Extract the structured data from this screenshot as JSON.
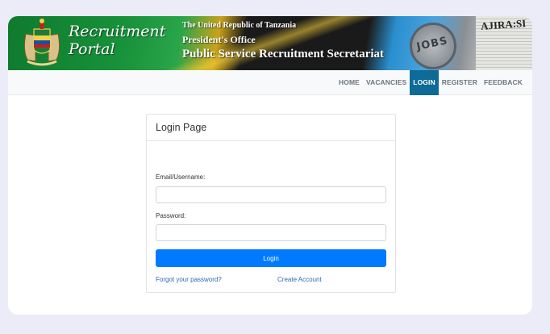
{
  "banner": {
    "portal_title_line1": "Recruitment",
    "portal_title_line2": "Portal",
    "gov_line1": "The United Republic of Tanzania",
    "gov_line2": "President's Office",
    "gov_line3": "Public Service Recruitment Secretariat",
    "stamp_text": "JOBS",
    "newspaper_text": "AJIRA:SI"
  },
  "nav": {
    "items": [
      {
        "label": "HOME"
      },
      {
        "label": "VACANCIES"
      },
      {
        "label": "LOGIN",
        "active": true
      },
      {
        "label": "REGISTER"
      },
      {
        "label": "FEEDBACK"
      }
    ]
  },
  "login": {
    "title": "Login Page",
    "username_label": "Email/Username:",
    "username_value": "",
    "password_label": "Password:",
    "password_value": "",
    "submit_label": "Login",
    "forgot_link": "Forgot your password?",
    "create_link": "Create Account"
  },
  "colors": {
    "page_background": "#ececf8",
    "nav_active": "#0e6a96",
    "primary_button": "#007bff",
    "link": "#2a6bb0"
  }
}
